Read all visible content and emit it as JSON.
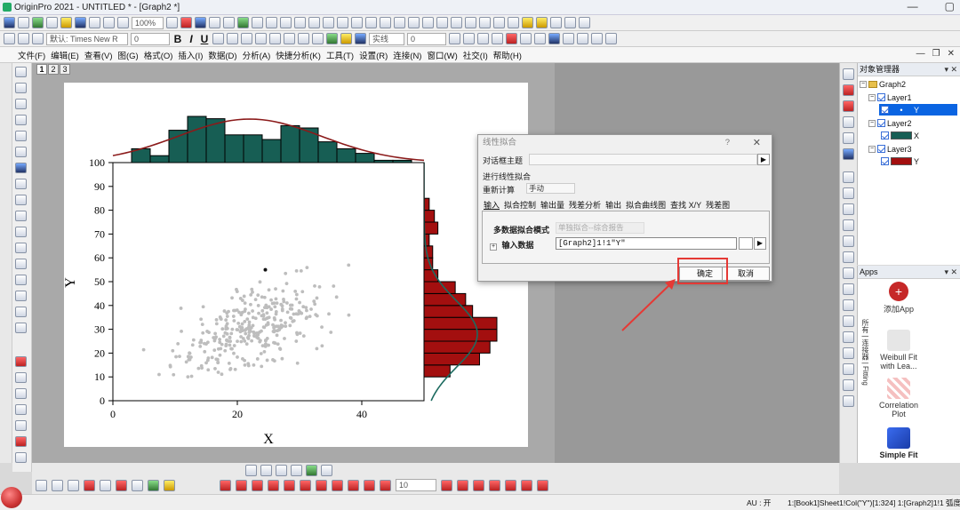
{
  "window": {
    "title": "OriginPro 2021 - UNTITLED * - [Graph2 *]"
  },
  "toolbar1": {
    "zoom": "100%"
  },
  "toolbar2": {
    "font_name": "默认: Times New R",
    "font_size": "0",
    "bold": "B",
    "italic": "I",
    "underline": "U",
    "line_style": "实线",
    "line_width": "0"
  },
  "menu": [
    "文件(F)",
    "编辑(E)",
    "查看(V)",
    "图(G)",
    "格式(O)",
    "插入(I)",
    "数据(D)",
    "分析(A)",
    "快捷分析(K)",
    "工具(T)",
    "设置(R)",
    "连接(N)",
    "窗口(W)",
    "社交(I)",
    "帮助(H)"
  ],
  "page_tabs": [
    "1",
    "2",
    "3"
  ],
  "graph": {
    "xlabel": "X",
    "ylabel": "Y",
    "xticks": [
      "0",
      "20",
      "40"
    ],
    "yticks": [
      "0",
      "10",
      "20",
      "30",
      "40",
      "50",
      "60",
      "70",
      "80",
      "90",
      "100"
    ],
    "top_hist_color": "#175e54",
    "right_hist_color": "#a30f0f",
    "scatter_color": "#bdbdbd"
  },
  "chart_data": {
    "type": "scatter",
    "xlabel": "X",
    "ylabel": "Y",
    "xlim": [
      0,
      50
    ],
    "ylim": [
      0,
      100
    ],
    "marginal_top": {
      "type": "bar",
      "bin_width": 3,
      "bin_starts": [
        3,
        6,
        9,
        12,
        15,
        18,
        21,
        24,
        27,
        30,
        33,
        36,
        39,
        42,
        45
      ],
      "counts": [
        6,
        3,
        14,
        20,
        19,
        12,
        12,
        10,
        16,
        15,
        9,
        6,
        4,
        1,
        1
      ]
    },
    "marginal_right": {
      "type": "bar",
      "bin_width": 5,
      "bin_starts": [
        10,
        15,
        20,
        25,
        30,
        35,
        40,
        45,
        50,
        55,
        60,
        65,
        70,
        75,
        80
      ],
      "counts": [
        15,
        32,
        38,
        42,
        42,
        28,
        24,
        18,
        8,
        5,
        5,
        3,
        8,
        6,
        3
      ]
    }
  },
  "dialog": {
    "title": "线性拟合",
    "help": "?",
    "close": "✕",
    "dialog_theme_label": "对话框主题",
    "recalc_section": "进行线性拟合",
    "recalc_label": "重新计算",
    "recalc_value": "手动",
    "tabs": [
      "输入",
      "拟合控制",
      "输出量",
      "残差分析",
      "输出",
      "拟合曲线图",
      "查找 X/Y",
      "残差图"
    ],
    "multi_mode_label": "多数据拟合模式",
    "multi_mode_value": "单独拟合--综合报告",
    "input_label": "输入数据",
    "input_value": "[Graph2]1!1\"Y\"",
    "ok": "确定",
    "cancel": "取消"
  },
  "object_manager": {
    "title": "对象管理器",
    "items": [
      {
        "label": "Graph2"
      },
      {
        "label": "Layer1"
      },
      {
        "label": "Y"
      },
      {
        "label": "Layer2"
      },
      {
        "label": "X",
        "color": "#175e54"
      },
      {
        "label": "Layer3"
      },
      {
        "label": "Y",
        "color": "#a30f0f"
      }
    ]
  },
  "apps": {
    "title": "Apps",
    "side_label": "所有 | 连接器 | Fitting",
    "items": [
      {
        "label": "添加App",
        "color": "#c62828"
      },
      {
        "label": "Weibull Fit with Lea...",
        "color": "#e6e6e6"
      },
      {
        "label": "Correlation Plot",
        "color": "#f0b0b0"
      },
      {
        "label": "Simple Fit",
        "color": "#2452c9"
      }
    ]
  },
  "bottom_toolbar": {
    "size_value": "10"
  },
  "status": {
    "au": "AU : 开",
    "info": "1:[Book1]Sheet1!Col(\"Y\")[1:324]  1:[Graph2]1!1  弧度"
  }
}
